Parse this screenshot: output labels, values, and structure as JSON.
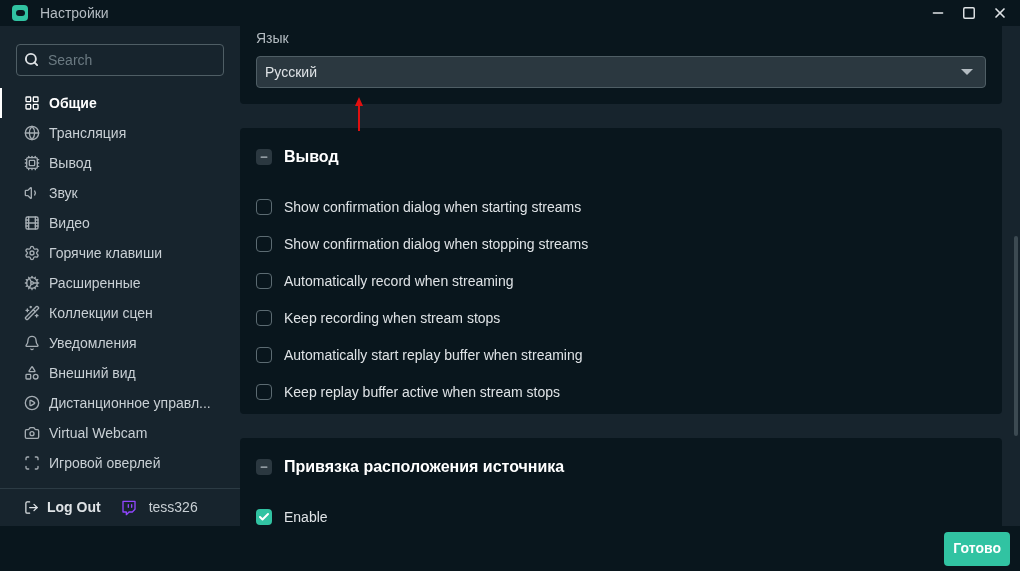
{
  "window": {
    "title": "Настройки"
  },
  "sidebar": {
    "search": {
      "placeholder": "Search"
    },
    "items": [
      {
        "kind": "grid",
        "label": "Общие",
        "selected": true
      },
      {
        "kind": "globe",
        "label": "Трансляция",
        "selected": false
      },
      {
        "kind": "chip",
        "label": "Вывод",
        "selected": false
      },
      {
        "kind": "sound",
        "label": "Звук",
        "selected": false
      },
      {
        "kind": "film",
        "label": "Видео",
        "selected": false
      },
      {
        "kind": "gear",
        "label": "Горячие клавиши",
        "selected": false
      },
      {
        "kind": "gears",
        "label": "Расширенные",
        "selected": false
      },
      {
        "kind": "wand",
        "label": "Коллекции сцен",
        "selected": false
      },
      {
        "kind": "bell",
        "label": "Уведомления",
        "selected": false
      },
      {
        "kind": "shapes",
        "label": "Внешний вид",
        "selected": false
      },
      {
        "kind": "play",
        "label": "Дистанционное управл...",
        "selected": false
      },
      {
        "kind": "camera",
        "label": "Virtual Webcam",
        "selected": false
      },
      {
        "kind": "expand",
        "label": "Игровой оверлей",
        "selected": false
      }
    ],
    "logout": "Log Out",
    "username": "tess326"
  },
  "language": {
    "label": "Язык",
    "value": "Русский"
  },
  "sections": [
    {
      "title": "Вывод",
      "expanded": true,
      "options": [
        {
          "label": "Show confirmation dialog when starting streams",
          "checked": false
        },
        {
          "label": "Show confirmation dialog when stopping streams",
          "checked": false
        },
        {
          "label": "Automatically record when streaming",
          "checked": false
        },
        {
          "label": "Keep recording when stream stops",
          "checked": false
        },
        {
          "label": "Automatically start replay buffer when streaming",
          "checked": false
        },
        {
          "label": "Keep replay buffer active when stream stops",
          "checked": false
        }
      ]
    },
    {
      "title": "Привязка расположения источника",
      "expanded": true,
      "options": [
        {
          "label": "Enable",
          "checked": true
        }
      ]
    }
  ],
  "done_button": "Готово"
}
